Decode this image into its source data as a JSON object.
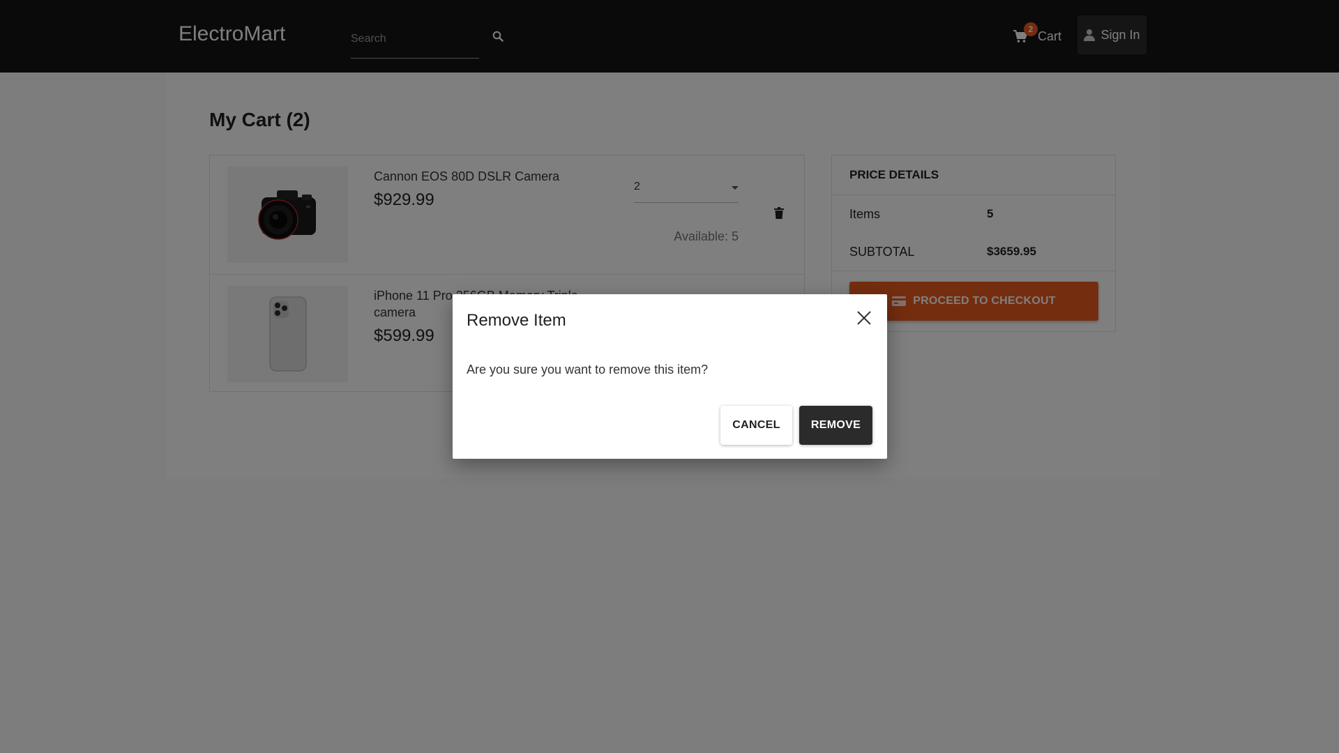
{
  "header": {
    "brand": "ElectroMart",
    "search_placeholder": "Search",
    "cart_label": "Cart",
    "cart_count": "2",
    "signin_label": "Sign In"
  },
  "cart": {
    "title": "My Cart (2)",
    "items": [
      {
        "name": "Cannon EOS 80D DSLR Camera",
        "price": "$929.99",
        "quantity": "2",
        "available": "Available: 5",
        "image_icon": "camera-image"
      },
      {
        "name": "iPhone 11 Pro 256GB Memory Triple-camera",
        "price": "$599.99",
        "image_icon": "phone-image"
      }
    ]
  },
  "price_details": {
    "heading": "PRICE DETAILS",
    "items_label": "Items",
    "items_value": "5",
    "subtotal_label": "SUBTOTAL",
    "subtotal_value": "$3659.95",
    "checkout_label": "PROCEED TO CHECKOUT"
  },
  "dialog": {
    "title": "Remove Item",
    "message": "Are you sure you want to remove this item?",
    "cancel_label": "CANCEL",
    "remove_label": "REMOVE"
  },
  "colors": {
    "header_bg": "#141414",
    "accent": "#e85a1f",
    "dark_button": "#2b2b2b"
  }
}
